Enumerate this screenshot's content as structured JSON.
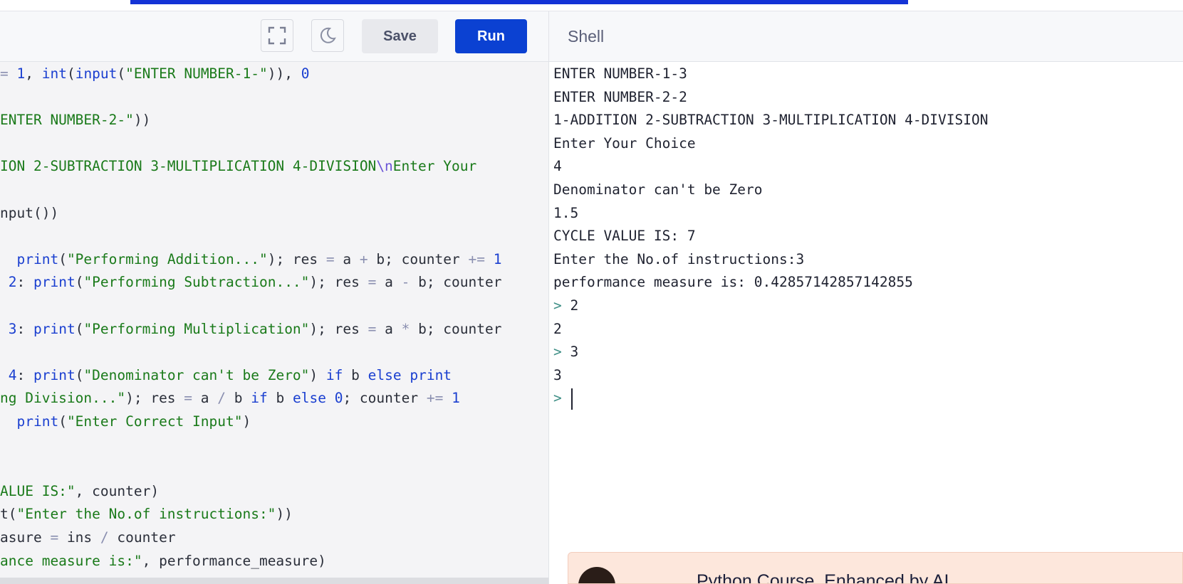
{
  "toolbar": {
    "save_label": "Save",
    "run_label": "Run"
  },
  "shell": {
    "title": "Shell",
    "lines": [
      {
        "prompt": "",
        "text": "ENTER NUMBER-1-3"
      },
      {
        "prompt": "",
        "text": "ENTER NUMBER-2-2"
      },
      {
        "prompt": "",
        "text": "1-ADDITION 2-SUBTRACTION 3-MULTIPLICATION 4-DIVISION"
      },
      {
        "prompt": "",
        "text": "Enter Your Choice"
      },
      {
        "prompt": "",
        "text": "4"
      },
      {
        "prompt": "",
        "text": "Denominator can't be Zero"
      },
      {
        "prompt": "",
        "text": "1.5"
      },
      {
        "prompt": "",
        "text": "CYCLE VALUE IS: 7"
      },
      {
        "prompt": "",
        "text": "Enter the No.of instructions:3"
      },
      {
        "prompt": "",
        "text": "performance measure is: 0.42857142857142855"
      },
      {
        "prompt": "> ",
        "text": "2"
      },
      {
        "prompt": "",
        "text": "2"
      },
      {
        "prompt": "> ",
        "text": "3"
      },
      {
        "prompt": "",
        "text": "3"
      },
      {
        "prompt": "> ",
        "text": ""
      }
    ]
  },
  "editor": {
    "lines": [
      [
        [
          "op",
          "= "
        ],
        [
          "num",
          "1"
        ],
        [
          "p",
          ", "
        ],
        [
          "fn",
          "int"
        ],
        [
          "p",
          "("
        ],
        [
          "fn",
          "input"
        ],
        [
          "p",
          "("
        ],
        [
          "str",
          "\"ENTER NUMBER-1-\""
        ],
        [
          "p",
          "))"
        ],
        [
          "p",
          ", "
        ],
        [
          "num",
          "0"
        ]
      ],
      [],
      [
        [
          "str",
          "ENTER NUMBER-2-\""
        ],
        [
          "p",
          "))"
        ]
      ],
      [],
      [
        [
          "str",
          "ION 2-SUBTRACTION 3-MULTIPLICATION 4-DIVISION"
        ],
        [
          "esc",
          "\\n"
        ],
        [
          "str",
          "Enter Your"
        ]
      ],
      [],
      [
        [
          "p",
          "nput())"
        ]
      ],
      [],
      [
        [
          "p",
          "  "
        ],
        [
          "fn",
          "print"
        ],
        [
          "p",
          "("
        ],
        [
          "str",
          "\"Performing Addition...\""
        ],
        [
          "p",
          "); res "
        ],
        [
          "op",
          "="
        ],
        [
          "p",
          " a "
        ],
        [
          "op",
          "+"
        ],
        [
          "p",
          " b; counter "
        ],
        [
          "op",
          "+="
        ],
        [
          "p",
          " "
        ],
        [
          "num",
          "1"
        ]
      ],
      [
        [
          "p",
          " "
        ],
        [
          "num",
          "2"
        ],
        [
          "p",
          ": "
        ],
        [
          "fn",
          "print"
        ],
        [
          "p",
          "("
        ],
        [
          "str",
          "\"Performing Subtraction...\""
        ],
        [
          "p",
          "); res "
        ],
        [
          "op",
          "="
        ],
        [
          "p",
          " a "
        ],
        [
          "op",
          "-"
        ],
        [
          "p",
          " b; counter"
        ]
      ],
      [],
      [
        [
          "p",
          " "
        ],
        [
          "num",
          "3"
        ],
        [
          "p",
          ": "
        ],
        [
          "fn",
          "print"
        ],
        [
          "p",
          "("
        ],
        [
          "str",
          "\"Performing Multiplication\""
        ],
        [
          "p",
          "); res "
        ],
        [
          "op",
          "="
        ],
        [
          "p",
          " a "
        ],
        [
          "op",
          "*"
        ],
        [
          "p",
          " b; counter"
        ]
      ],
      [],
      [
        [
          "p",
          " "
        ],
        [
          "num",
          "4"
        ],
        [
          "p",
          ": "
        ],
        [
          "fn",
          "print"
        ],
        [
          "p",
          "("
        ],
        [
          "str",
          "\"Denominator can't be Zero\""
        ],
        [
          "p",
          ") "
        ],
        [
          "kw",
          "if"
        ],
        [
          "p",
          " b "
        ],
        [
          "kw",
          "else"
        ],
        [
          "p",
          " "
        ],
        [
          "fn",
          "print"
        ]
      ],
      [
        [
          "str",
          "ng Division...\""
        ],
        [
          "p",
          "); res "
        ],
        [
          "op",
          "="
        ],
        [
          "p",
          " a "
        ],
        [
          "op",
          "/"
        ],
        [
          "p",
          " b "
        ],
        [
          "kw",
          "if"
        ],
        [
          "p",
          " b "
        ],
        [
          "kw",
          "else"
        ],
        [
          "p",
          " "
        ],
        [
          "num",
          "0"
        ],
        [
          "p",
          "; counter "
        ],
        [
          "op",
          "+="
        ],
        [
          "p",
          " "
        ],
        [
          "num",
          "1"
        ]
      ],
      [
        [
          "p",
          "  "
        ],
        [
          "fn",
          "print"
        ],
        [
          "p",
          "("
        ],
        [
          "str",
          "\"Enter Correct Input\""
        ],
        [
          "p",
          ")"
        ]
      ],
      [],
      [],
      [
        [
          "str",
          "ALUE IS:\""
        ],
        [
          "p",
          ", counter)"
        ]
      ],
      [
        [
          "p",
          "t("
        ],
        [
          "str",
          "\"Enter the No.of instructions:\""
        ],
        [
          "p",
          "))"
        ]
      ],
      [
        [
          "p",
          "asure "
        ],
        [
          "op",
          "="
        ],
        [
          "p",
          " ins "
        ],
        [
          "op",
          "/"
        ],
        [
          "p",
          " counter"
        ]
      ],
      [
        [
          "str",
          "ance measure is:\""
        ],
        [
          "p",
          ", performance_measure)"
        ]
      ]
    ]
  },
  "ad": {
    "text": "Python Course, Enhanced by AI"
  },
  "colors": {
    "run_button": "#0b41d2",
    "top_bar": "#1433d6"
  }
}
